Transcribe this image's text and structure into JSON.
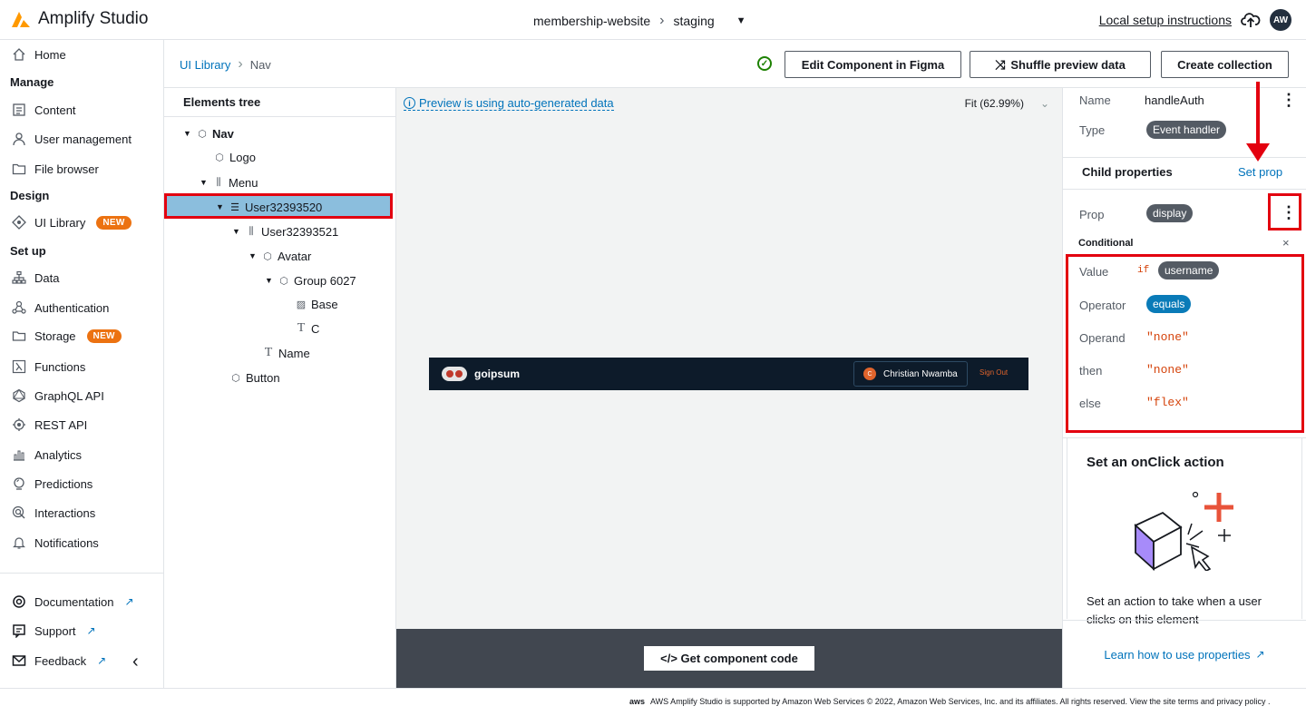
{
  "app": {
    "title": "Amplify Studio"
  },
  "project": {
    "name": "membership-website",
    "environment": "staging"
  },
  "header": {
    "local_setup": "Local setup instructions",
    "user_initials": "AW"
  },
  "sidebar": {
    "home": "Home",
    "sections": {
      "manage": "Manage",
      "design": "Design",
      "setup": "Set up"
    },
    "manage_items": [
      "Content",
      "User management",
      "File browser"
    ],
    "design_items": [
      "UI Library"
    ],
    "setup_items": [
      "Data",
      "Authentication",
      "Storage",
      "Functions",
      "GraphQL API",
      "REST API",
      "Analytics",
      "Predictions",
      "Interactions",
      "Notifications"
    ],
    "badge_new": "NEW",
    "bottom_items": [
      "Documentation",
      "Support",
      "Feedback"
    ]
  },
  "breadcrumb": {
    "parent": "UI Library",
    "current": "Nav"
  },
  "toolbar": {
    "edit_figma": "Edit Component in Figma",
    "shuffle": "Shuffle preview data",
    "create_collection": "Create collection"
  },
  "tree": {
    "title": "Elements tree",
    "nodes": [
      "Nav",
      "Logo",
      "Menu",
      "User32393520",
      "User32393521",
      "Avatar",
      "Group 6027",
      "Base",
      "C",
      "Name",
      "Button"
    ]
  },
  "preview": {
    "note": "Preview is using auto-generated data",
    "zoom": "Fit (62.99%)",
    "brand": "goipsum",
    "user_initial": "C",
    "user_name": "Christian Nwamba",
    "sign_out": "Sign Out"
  },
  "code_button": "</> Get component code",
  "props": {
    "name_label": "Name",
    "name_value": "handleAuth",
    "type_label": "Type",
    "type_value": "Event handler",
    "child_title": "Child properties",
    "set_prop": "Set prop",
    "prop_label": "Prop",
    "prop_value": "display",
    "conditional": "Conditional",
    "value_label": "Value",
    "value_if": "if",
    "value_pill": "username",
    "operator_label": "Operator",
    "operator_value": "equals",
    "operand_label": "Operand",
    "operand_value": "\"none\"",
    "then_label": "then",
    "then_value": "\"none\"",
    "else_label": "else",
    "else_value": "\"flex\"",
    "onclick_title": "Set an onClick action",
    "onclick_desc": "Set an action to take when a user clicks on this element",
    "learn": "Learn how to use properties"
  },
  "footer": {
    "aws": "aws",
    "text": "AWS Amplify Studio is supported by Amazon Web Services © 2022, Amazon Web Services, Inc. and its affiliates. All rights reserved. View the site terms and privacy policy ."
  },
  "colors": {
    "accent": "#0073bb",
    "badge": "#ec7211",
    "highlight": "#e3000f",
    "selected": "#8bbedd"
  }
}
